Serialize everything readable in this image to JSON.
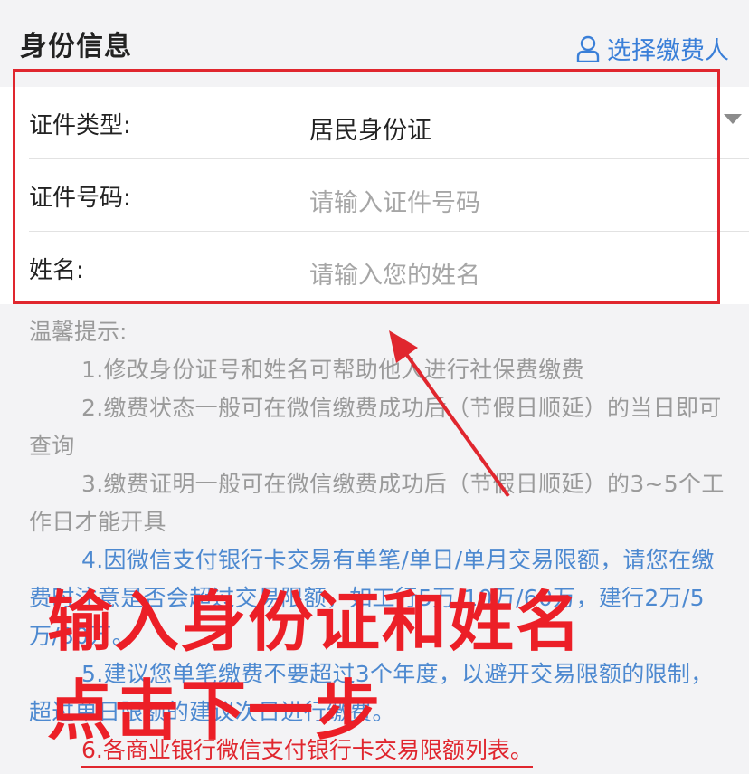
{
  "header": {
    "title": "身份信息",
    "select_payer_label": "选择缴费人"
  },
  "form": {
    "rows": [
      {
        "label": "证件类型:",
        "value": "居民身份证"
      },
      {
        "label": "证件号码:",
        "placeholder": "请输入证件号码"
      },
      {
        "label": "姓名:",
        "placeholder": "请输入您的姓名"
      }
    ]
  },
  "tips": {
    "heading": "温馨提示:",
    "items": [
      "1.修改身份证号和姓名可帮助他人进行社保费缴费",
      "2.缴费状态一般可在微信缴费成功后（节假日顺延）的当日即可查询",
      "3.缴费证明一般可在微信缴费成功后（节假日顺延）的3~5个工作日才能开具",
      "4.因微信支付银行卡交易有单笔/单日/单月交易限额，请您在缴费时注意是否会超过交易限额，如工行5万/10万/60万，建行2万/5万/30万。",
      "5.建议您单笔缴费不要超过3个年度，以避开交易限额的限制，超过单日限额的建议次日进行缴费。"
    ],
    "link": "6.各商业银行微信支付银行卡交易限额列表。"
  },
  "overlay": {
    "line1": "输入身份证和姓名",
    "line2": "点击下一步"
  },
  "colors": {
    "accent_blue": "#3a7fd8",
    "annotation_red": "#e0262e",
    "placeholder_gray": "#a6a6a6"
  }
}
